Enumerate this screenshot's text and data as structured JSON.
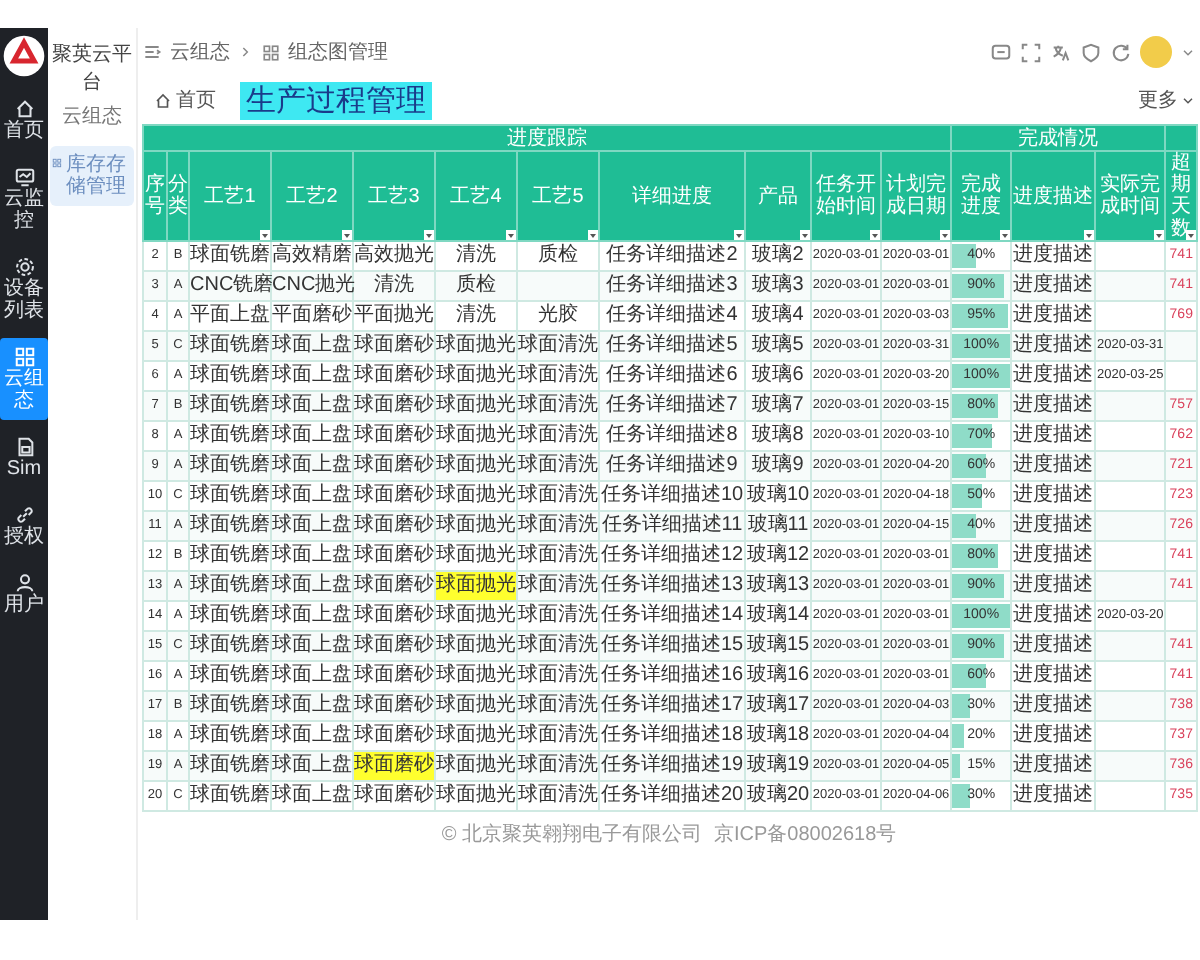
{
  "sidebar": {
    "items": [
      {
        "label": "首页",
        "selected": false
      },
      {
        "label": "云监控",
        "selected": false
      },
      {
        "label": "设备列表",
        "selected": false
      },
      {
        "label": "云组态",
        "selected": true
      },
      {
        "label": "Sim",
        "selected": false
      },
      {
        "label": "授权",
        "selected": false
      },
      {
        "label": "用户",
        "selected": false
      }
    ]
  },
  "panel": {
    "title": "聚英云平台",
    "subtitle": "云组态",
    "menu": [
      {
        "label": "库存存储管理",
        "selected": true
      }
    ]
  },
  "breadcrumb": [
    "云组态",
    "组态图管理"
  ],
  "tabs": [
    {
      "label": "首页",
      "selected": false
    }
  ],
  "page_title": "生产过程管理",
  "more": "更多",
  "table": {
    "group_headers": [
      "进度跟踪",
      "完成情况"
    ],
    "columns": [
      "序号",
      "分类",
      "工艺1",
      "工艺2",
      "工艺3",
      "工艺4",
      "工艺5",
      "详细进度",
      "产品",
      "任务开始时间",
      "计划完成日期",
      "完成进度",
      "进度描述",
      "实际完成时间",
      "超期天数"
    ],
    "rows": [
      {
        "no": "2",
        "category": "B",
        "steps": [
          {
            "text": "球面铣磨",
            "highlighted": false
          },
          {
            "text": "高效精磨",
            "highlighted": false
          },
          {
            "text": "高效抛光",
            "highlighted": false
          },
          {
            "text": "清洗",
            "highlighted": false
          },
          {
            "text": "质检",
            "highlighted": false
          }
        ],
        "detail": "任务详细描述2",
        "product": "玻璃2",
        "start": "2020-03-01",
        "planned": "2020-03-01",
        "level": 0.4,
        "progress": "40%",
        "description": "进度描述",
        "overdue": "741"
      },
      {
        "no": "3",
        "category": "A",
        "steps": [
          {
            "text": "CNC铣磨",
            "highlighted": false
          },
          {
            "text": "CNC抛光",
            "highlighted": false
          },
          {
            "text": "清洗",
            "highlighted": false
          },
          {
            "text": "质检",
            "highlighted": false
          }
        ],
        "detail": "任务详细描述3",
        "product": "玻璃3",
        "start": "2020-03-01",
        "planned": "2020-03-01",
        "level": 0.9,
        "progress": "90%",
        "description": "进度描述",
        "overdue": "741"
      },
      {
        "no": "4",
        "category": "A",
        "steps": [
          {
            "text": "平面上盘",
            "highlighted": false
          },
          {
            "text": "平面磨砂",
            "highlighted": false
          },
          {
            "text": "平面抛光",
            "highlighted": false
          },
          {
            "text": "清洗",
            "highlighted": false
          },
          {
            "text": "光胶",
            "highlighted": false
          }
        ],
        "detail": "任务详细描述4",
        "product": "玻璃4",
        "start": "2020-03-01",
        "planned": "2020-03-03",
        "level": 0.95,
        "progress": "95%",
        "description": "进度描述",
        "overdue": "769"
      },
      {
        "no": "5",
        "category": "C",
        "steps": [
          {
            "text": "球面铣磨",
            "highlighted": false
          },
          {
            "text": "球面上盘",
            "highlighted": false
          },
          {
            "text": "球面磨砂",
            "highlighted": false
          },
          {
            "text": "球面抛光",
            "highlighted": false
          },
          {
            "text": "球面清洗",
            "highlighted": false
          }
        ],
        "detail": "任务详细描述5",
        "product": "玻璃5",
        "start": "2020-03-01",
        "planned": "2020-03-31",
        "level": 1,
        "progress": "100%",
        "description": "进度描述",
        "actual": "2020-03-31"
      },
      {
        "no": "6",
        "category": "A",
        "steps": [
          {
            "text": "球面铣磨",
            "highlighted": false
          },
          {
            "text": "球面上盘",
            "highlighted": false
          },
          {
            "text": "球面磨砂",
            "highlighted": false
          },
          {
            "text": "球面抛光",
            "highlighted": false
          },
          {
            "text": "球面清洗",
            "highlighted": false
          }
        ],
        "detail": "任务详细描述6",
        "product": "玻璃6",
        "start": "2020-03-01",
        "planned": "2020-03-20",
        "level": 1,
        "progress": "100%",
        "description": "进度描述",
        "actual": "2020-03-25"
      },
      {
        "no": "7",
        "category": "B",
        "steps": [
          {
            "text": "球面铣磨",
            "highlighted": false
          },
          {
            "text": "球面上盘",
            "highlighted": false
          },
          {
            "text": "球面磨砂",
            "highlighted": false
          },
          {
            "text": "球面抛光",
            "highlighted": false
          },
          {
            "text": "球面清洗",
            "highlighted": false
          }
        ],
        "detail": "任务详细描述7",
        "product": "玻璃7",
        "start": "2020-03-01",
        "planned": "2020-03-15",
        "level": 0.8,
        "progress": "80%",
        "description": "进度描述",
        "overdue": "757"
      },
      {
        "no": "8",
        "category": "A",
        "steps": [
          {
            "text": "球面铣磨",
            "highlighted": false
          },
          {
            "text": "球面上盘",
            "highlighted": false
          },
          {
            "text": "球面磨砂",
            "highlighted": false
          },
          {
            "text": "球面抛光",
            "highlighted": false
          },
          {
            "text": "球面清洗",
            "highlighted": false
          }
        ],
        "detail": "任务详细描述8",
        "product": "玻璃8",
        "start": "2020-03-01",
        "planned": "2020-03-10",
        "level": 0.7,
        "progress": "70%",
        "description": "进度描述",
        "overdue": "762"
      },
      {
        "no": "9",
        "category": "A",
        "steps": [
          {
            "text": "球面铣磨",
            "highlighted": false
          },
          {
            "text": "球面上盘",
            "highlighted": false
          },
          {
            "text": "球面磨砂",
            "highlighted": false
          },
          {
            "text": "球面抛光",
            "highlighted": false
          },
          {
            "text": "球面清洗",
            "highlighted": false
          }
        ],
        "detail": "任务详细描述9",
        "product": "玻璃9",
        "start": "2020-03-01",
        "planned": "2020-04-20",
        "level": 0.6,
        "progress": "60%",
        "description": "进度描述",
        "overdue": "721"
      },
      {
        "no": "10",
        "category": "C",
        "steps": [
          {
            "text": "球面铣磨",
            "highlighted": false
          },
          {
            "text": "球面上盘",
            "highlighted": false
          },
          {
            "text": "球面磨砂",
            "highlighted": false
          },
          {
            "text": "球面抛光",
            "highlighted": false
          },
          {
            "text": "球面清洗",
            "highlighted": false
          }
        ],
        "detail": "任务详细描述10",
        "product": "玻璃10",
        "start": "2020-03-01",
        "planned": "2020-04-18",
        "level": 0.5,
        "progress": "50%",
        "description": "进度描述",
        "overdue": "723"
      },
      {
        "no": "11",
        "category": "A",
        "steps": [
          {
            "text": "球面铣磨",
            "highlighted": false
          },
          {
            "text": "球面上盘",
            "highlighted": false
          },
          {
            "text": "球面磨砂",
            "highlighted": false
          },
          {
            "text": "球面抛光",
            "highlighted": false
          },
          {
            "text": "球面清洗",
            "highlighted": false
          }
        ],
        "detail": "任务详细描述11",
        "product": "玻璃11",
        "start": "2020-03-01",
        "planned": "2020-04-15",
        "level": 0.4,
        "progress": "40%",
        "description": "进度描述",
        "overdue": "726"
      },
      {
        "no": "12",
        "category": "B",
        "steps": [
          {
            "text": "球面铣磨",
            "highlighted": false
          },
          {
            "text": "球面上盘",
            "highlighted": false
          },
          {
            "text": "球面磨砂",
            "highlighted": false
          },
          {
            "text": "球面抛光",
            "highlighted": false
          },
          {
            "text": "球面清洗",
            "highlighted": false
          }
        ],
        "detail": "任务详细描述12",
        "product": "玻璃12",
        "start": "2020-03-01",
        "planned": "2020-03-01",
        "level": 0.8,
        "progress": "80%",
        "description": "进度描述",
        "overdue": "741"
      },
      {
        "no": "13",
        "category": "A",
        "steps": [
          {
            "text": "球面铣磨",
            "highlighted": false
          },
          {
            "text": "球面上盘",
            "highlighted": false
          },
          {
            "text": "球面磨砂",
            "highlighted": false
          },
          {
            "text": "球面抛光",
            "highlighted": true
          },
          {
            "text": "球面清洗",
            "highlighted": false
          }
        ],
        "detail": "任务详细描述13",
        "product": "玻璃13",
        "start": "2020-03-01",
        "planned": "2020-03-01",
        "level": 0.9,
        "progress": "90%",
        "description": "进度描述",
        "overdue": "741"
      },
      {
        "no": "14",
        "category": "A",
        "steps": [
          {
            "text": "球面铣磨",
            "highlighted": false
          },
          {
            "text": "球面上盘",
            "highlighted": false
          },
          {
            "text": "球面磨砂",
            "highlighted": false
          },
          {
            "text": "球面抛光",
            "highlighted": false
          },
          {
            "text": "球面清洗",
            "highlighted": false
          }
        ],
        "detail": "任务详细描述14",
        "product": "玻璃14",
        "start": "2020-03-01",
        "planned": "2020-03-01",
        "level": 1,
        "progress": "100%",
        "description": "进度描述",
        "actual": "2020-03-20"
      },
      {
        "no": "15",
        "category": "C",
        "steps": [
          {
            "text": "球面铣磨",
            "highlighted": false
          },
          {
            "text": "球面上盘",
            "highlighted": false
          },
          {
            "text": "球面磨砂",
            "highlighted": false
          },
          {
            "text": "球面抛光",
            "highlighted": false
          },
          {
            "text": "球面清洗",
            "highlighted": false
          }
        ],
        "detail": "任务详细描述15",
        "product": "玻璃15",
        "start": "2020-03-01",
        "planned": "2020-03-01",
        "level": 0.9,
        "progress": "90%",
        "description": "进度描述",
        "overdue": "741"
      },
      {
        "no": "16",
        "category": "A",
        "steps": [
          {
            "text": "球面铣磨",
            "highlighted": false
          },
          {
            "text": "球面上盘",
            "highlighted": false
          },
          {
            "text": "球面磨砂",
            "highlighted": false
          },
          {
            "text": "球面抛光",
            "highlighted": false
          },
          {
            "text": "球面清洗",
            "highlighted": false
          }
        ],
        "detail": "任务详细描述16",
        "product": "玻璃16",
        "start": "2020-03-01",
        "planned": "2020-03-01",
        "level": 0.6,
        "progress": "60%",
        "description": "进度描述",
        "overdue": "741"
      },
      {
        "no": "17",
        "category": "B",
        "steps": [
          {
            "text": "球面铣磨",
            "highlighted": false
          },
          {
            "text": "球面上盘",
            "highlighted": false
          },
          {
            "text": "球面磨砂",
            "highlighted": false
          },
          {
            "text": "球面抛光",
            "highlighted": false
          },
          {
            "text": "球面清洗",
            "highlighted": false
          }
        ],
        "detail": "任务详细描述17",
        "product": "玻璃17",
        "start": "2020-03-01",
        "planned": "2020-04-03",
        "level": 0.3,
        "progress": "30%",
        "description": "进度描述",
        "overdue": "738"
      },
      {
        "no": "18",
        "category": "A",
        "steps": [
          {
            "text": "球面铣磨",
            "highlighted": false
          },
          {
            "text": "球面上盘",
            "highlighted": false
          },
          {
            "text": "球面磨砂",
            "highlighted": false
          },
          {
            "text": "球面抛光",
            "highlighted": false
          },
          {
            "text": "球面清洗",
            "highlighted": false
          }
        ],
        "detail": "任务详细描述18",
        "product": "玻璃18",
        "start": "2020-03-01",
        "planned": "2020-04-04",
        "level": 0.2,
        "progress": "20%",
        "description": "进度描述",
        "overdue": "737"
      },
      {
        "no": "19",
        "category": "A",
        "steps": [
          {
            "text": "球面铣磨",
            "highlighted": false
          },
          {
            "text": "球面上盘",
            "highlighted": false
          },
          {
            "text": "球面磨砂",
            "highlighted": true
          },
          {
            "text": "球面抛光",
            "highlighted": false
          },
          {
            "text": "球面清洗",
            "highlighted": false
          }
        ],
        "detail": "任务详细描述19",
        "product": "玻璃19",
        "start": "2020-03-01",
        "planned": "2020-04-05",
        "level": 0.15,
        "progress": "15%",
        "description": "进度描述",
        "overdue": "736"
      },
      {
        "no": "20",
        "category": "C",
        "steps": [
          {
            "text": "球面铣磨",
            "highlighted": false
          },
          {
            "text": "球面上盘",
            "highlighted": false
          },
          {
            "text": "球面磨砂",
            "highlighted": false
          },
          {
            "text": "球面抛光",
            "highlighted": false
          },
          {
            "text": "球面清洗",
            "highlighted": false
          }
        ],
        "detail": "任务详细描述20",
        "product": "玻璃20",
        "start": "2020-03-01",
        "planned": "2020-04-06",
        "level": 0.3,
        "progress": "30%",
        "description": "进度描述",
        "overdue": "735"
      }
    ]
  },
  "footer": {
    "copyright": "© 北京聚英翱翔电子有限公司",
    "icp": "京ICP备08002618号"
  }
}
